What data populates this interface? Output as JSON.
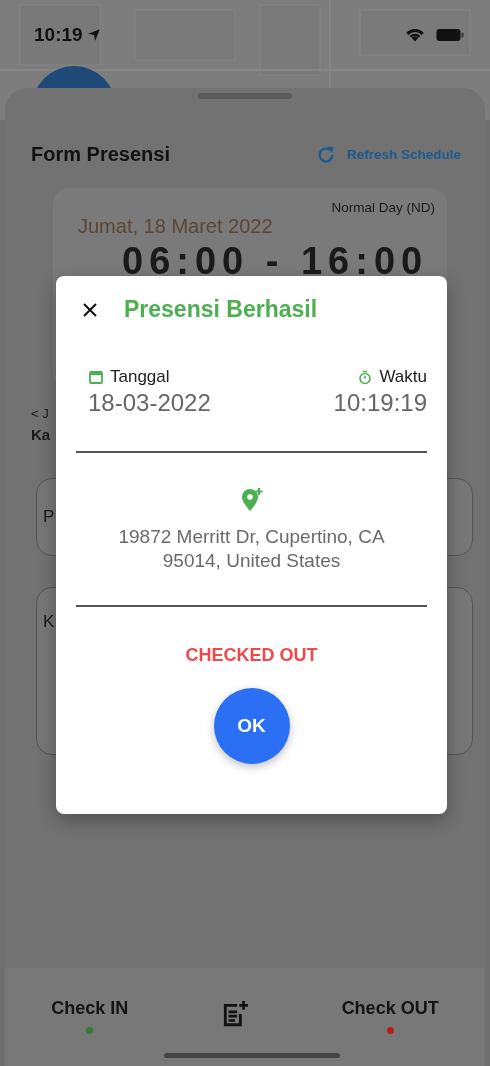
{
  "status_bar": {
    "time": "10:19"
  },
  "form": {
    "title": "Form Presensi",
    "refresh": "Refresh Schedule",
    "schedule_card": {
      "day_type": "Normal Day (ND)",
      "date": "Jumat, 18 Maret 2022",
      "hours": "06:00 - 16:00"
    },
    "back_link": "< J",
    "field_label": "Ka",
    "field_1": "P",
    "field_2": "K"
  },
  "dialog": {
    "title": "Presensi Berhasil",
    "date_label": "Tanggal",
    "date": "18-03-2022",
    "time_label": "Waktu",
    "time": "10:19:19",
    "address": "19872 Merritt Dr, Cupertino, CA 95014, United States",
    "status": "CHECKED OUT",
    "ok": "OK"
  },
  "bottom_bar": {
    "actions": [
      {
        "label": "Check IN",
        "color": "#2e7d32"
      },
      {
        "label": "Check OUT",
        "color": "#b71c1c"
      }
    ]
  }
}
